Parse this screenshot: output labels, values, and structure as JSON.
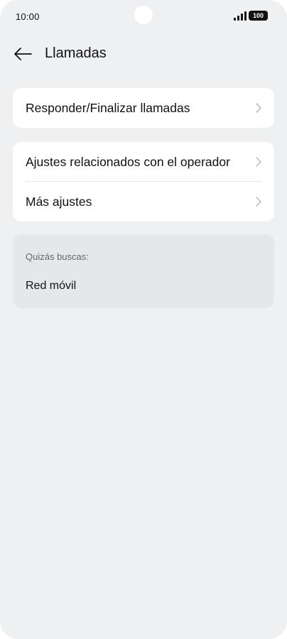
{
  "status_bar": {
    "time": "10:00",
    "battery": "100"
  },
  "header": {
    "back_icon": "arrow-left-icon",
    "title": "Llamadas"
  },
  "cards": [
    {
      "items": [
        {
          "label": "Responder/Finalizar llamadas",
          "icon": "chevron-right-icon"
        }
      ]
    },
    {
      "items": [
        {
          "label": "Ajustes relacionados con el operador",
          "icon": "chevron-right-icon"
        },
        {
          "label": "Más ajustes",
          "icon": "chevron-right-icon"
        }
      ]
    }
  ],
  "suggestions": {
    "caption": "Quizás buscas:",
    "items": [
      "Red móvil"
    ]
  },
  "colors": {
    "background": "#eff0f2",
    "card": "#ffffff",
    "suggestion_card": "#e6e7e9"
  }
}
